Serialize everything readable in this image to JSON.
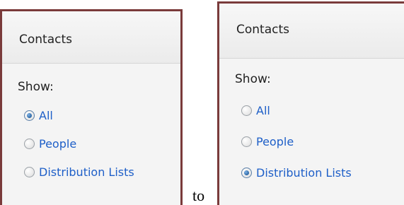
{
  "before": {
    "title": "Contacts",
    "show_label": "Show:",
    "options": [
      {
        "label": "All",
        "checked": true
      },
      {
        "label": "People",
        "checked": false
      },
      {
        "label": "Distribution Lists",
        "checked": false
      }
    ]
  },
  "connector": "to",
  "after": {
    "title": "Contacts",
    "show_label": "Show:",
    "options": [
      {
        "label": "All",
        "checked": false
      },
      {
        "label": "People",
        "checked": false
      },
      {
        "label": "Distribution Lists",
        "checked": true
      }
    ]
  },
  "colors": {
    "frame": "#7a3b3b",
    "link": "#1e5fc8",
    "panel_bg": "#f4f4f4"
  }
}
